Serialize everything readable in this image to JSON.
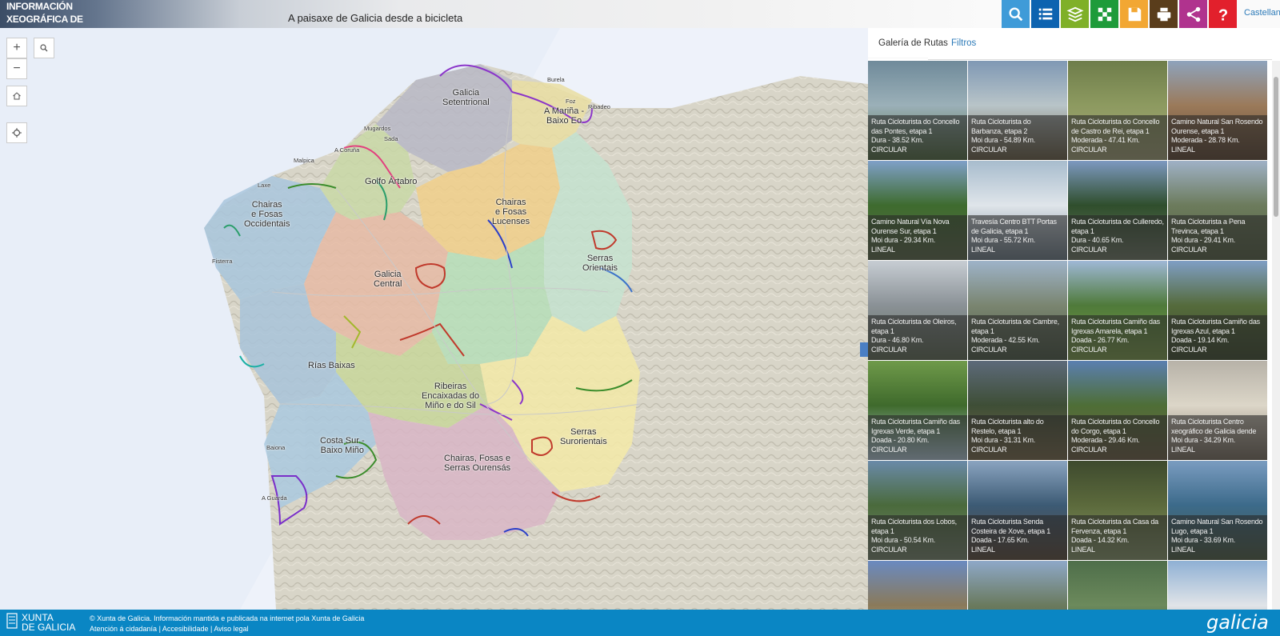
{
  "header": {
    "logo_line1": "INFORMACIÓN",
    "logo_line2": "XEOGRÁFICA DE GALICIA",
    "title": "A paisaxe de Galicia desde a bicicleta",
    "language": "Castellano",
    "toolbar": [
      {
        "icon": "search-icon",
        "color": "#3f9bd8"
      },
      {
        "icon": "list-icon",
        "color": "#0d63b0"
      },
      {
        "icon": "layers-icon",
        "color": "#7fb028"
      },
      {
        "icon": "basemap-icon",
        "color": "#1e9b3a"
      },
      {
        "icon": "save-icon",
        "color": "#f2a733"
      },
      {
        "icon": "print-icon",
        "color": "#5a3d1b"
      },
      {
        "icon": "share-icon",
        "color": "#b0338e"
      },
      {
        "icon": "help-icon",
        "color": "#e2202c"
      }
    ]
  },
  "map": {
    "controls": {
      "zoom_in": "+",
      "zoom_out": "−"
    },
    "region_labels": [
      "Galicia\nSetentrional",
      "A Mariña -\nBaixo Eo",
      "Golfo Ártabro",
      "Chairas\ne Fosas\nOccidentais",
      "Chairas\ne Fosas\nLucenses",
      "Galicia\nCentral",
      "Serras\nOrientais",
      "Rías Baixas",
      "Ribeiras\nEncaixadas do\nMiño e do Sil",
      "Serras\nSurorientais",
      "Costa Sur -\nBaixo Miño",
      "Chairas, Fosas e\nSerras Ourensás"
    ],
    "city_labels": [
      "A Coruña",
      "Malpica",
      "Laxe",
      "Fisterra",
      "Baiona",
      "A Guarda",
      "Burela",
      "Foz",
      "Ribadeo",
      "Mugardos",
      "Sada"
    ]
  },
  "panel": {
    "tabs": [
      "Galería de Rutas",
      "Filtros"
    ],
    "routes": [
      {
        "name": "Ruta Cicloturista do Concello das Pontes, etapa 1",
        "meta": "Dura - 38.52 Km.",
        "kind": "CIRCULAR"
      },
      {
        "name": "Ruta Cicloturista do Barbanza, etapa 2",
        "meta": "Moi dura - 54.89 Km.",
        "kind": "CIRCULAR"
      },
      {
        "name": "Ruta Cicloturista do Concello de Castro de Rei, etapa 1",
        "meta": "Moderada - 47.41 Km.",
        "kind": "CIRCULAR"
      },
      {
        "name": "Camino Natural San Rosendo Ourense, etapa 1",
        "meta": "Moderada - 28.78 Km.",
        "kind": "LINEAL"
      },
      {
        "name": "Camino Natural Vía Nova Ourense Sur, etapa 1",
        "meta": "Moi dura - 29.34 Km.",
        "kind": "LINEAL"
      },
      {
        "name": "Travesía Centro BTT Portas de Galicia, etapa 1",
        "meta": "Moi dura - 55.72 Km.",
        "kind": "LINEAL"
      },
      {
        "name": "Ruta Cicloturista de Culleredo, etapa 1",
        "meta": "Dura - 40.65 Km.",
        "kind": "CIRCULAR"
      },
      {
        "name": "Ruta Cicloturista a Pena Trevinca, etapa 1",
        "meta": "Moi dura - 29.41 Km.",
        "kind": "CIRCULAR"
      },
      {
        "name": "Ruta Cicloturista de Oleiros, etapa 1",
        "meta": "Dura - 46.80 Km.",
        "kind": "CIRCULAR"
      },
      {
        "name": "Ruta Cicloturista de Cambre, etapa 1",
        "meta": "Moderada - 42.55 Km.",
        "kind": "CIRCULAR"
      },
      {
        "name": "Ruta Cicloturista Camiño das Igrexas Amarela, etapa 1",
        "meta": "Doada - 26.77 Km.",
        "kind": "CIRCULAR"
      },
      {
        "name": "Ruta Cicloturista Camiño das Igrexas Azul, etapa 1",
        "meta": "Doada - 19.14 Km.",
        "kind": "CIRCULAR"
      },
      {
        "name": "Ruta Cicloturista Camiño das Igrexas Verde, etapa 1",
        "meta": "Doada - 20.80 Km.",
        "kind": "CIRCULAR"
      },
      {
        "name": "Ruta Cicloturista alto do Restelo, etapa 1",
        "meta": "Moi dura - 31.31 Km.",
        "kind": "CIRCULAR"
      },
      {
        "name": "Ruta Cicloturista do Concello do Corgo, etapa 1",
        "meta": "Moderada - 29.46 Km.",
        "kind": "CIRCULAR"
      },
      {
        "name": "Ruta Cicloturista Centro xeográfico de Galicia dende",
        "meta": "Moi dura - 34.29 Km.",
        "kind": "LINEAL"
      },
      {
        "name": "Ruta Cicloturista dos Lobos, etapa 1",
        "meta": "Moi dura - 50.54 Km.",
        "kind": "CIRCULAR"
      },
      {
        "name": "Ruta Cicloturista Senda Costeira de Xove, etapa 1",
        "meta": "Doada - 17.65 Km.",
        "kind": "LINEAL"
      },
      {
        "name": "Ruta Cicloturista da Casa da Fervenza, etapa 1",
        "meta": "Doada - 14.32 Km.",
        "kind": "LINEAL"
      },
      {
        "name": "Camino Natural San Rosendo Lugo, etapa 1",
        "meta": "Moi dura - 33.69 Km.",
        "kind": "LINEAL"
      },
      {
        "name": "",
        "meta": "",
        "kind": ""
      },
      {
        "name": "",
        "meta": "",
        "kind": ""
      },
      {
        "name": "",
        "meta": "",
        "kind": ""
      },
      {
        "name": "",
        "meta": "",
        "kind": ""
      }
    ]
  },
  "footer": {
    "brand_line1": "XUNTA",
    "brand_line2": "DE GALICIA",
    "copyright": "© Xunta de Galicia. Información mantida e publicada na internet pola Xunta de Galicia",
    "links": [
      "Atención á cidadanía",
      "Accesibilidade",
      "Aviso legal"
    ],
    "galicia": "galicia"
  }
}
